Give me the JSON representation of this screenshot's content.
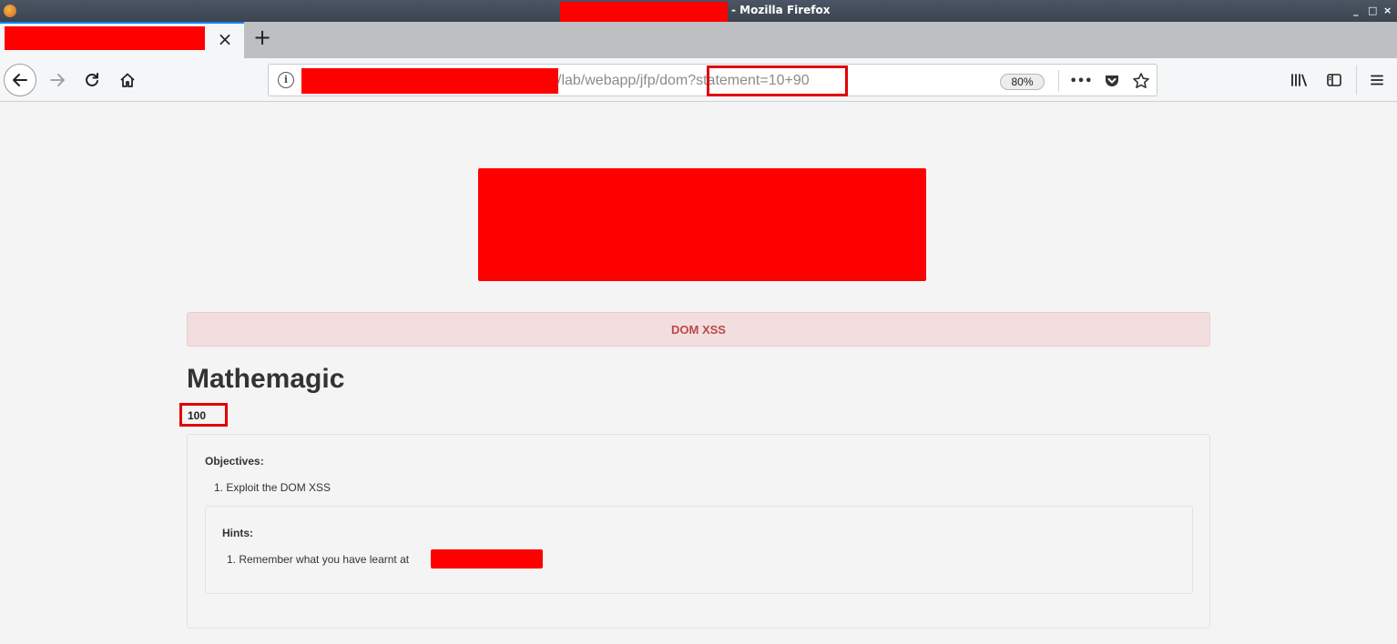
{
  "window": {
    "title": "- Mozilla Firefox",
    "controls": [
      "_",
      "□",
      "×"
    ]
  },
  "tabs": {
    "close_symbol": "×",
    "new_tab_symbol": "+"
  },
  "toolbar": {
    "url_path": "/lab/webapp/jfp/dom?statement=10+90",
    "zoom": "80%",
    "page_actions_symbol": "•••"
  },
  "page": {
    "alert": "DOM XSS",
    "title": "Mathemagic",
    "result": "100",
    "objectives_heading": "Objectives:",
    "objectives": [
      "1. Exploit the DOM XSS"
    ],
    "hints_heading": "Hints:",
    "hints": [
      "1. Remember what you have learnt at"
    ]
  },
  "colors": {
    "redaction": "#ff0000",
    "highlight_box": "#e00000",
    "alert_bg": "#f2dede",
    "alert_text": "#b94a48",
    "page_bg": "#f4f4f4"
  }
}
